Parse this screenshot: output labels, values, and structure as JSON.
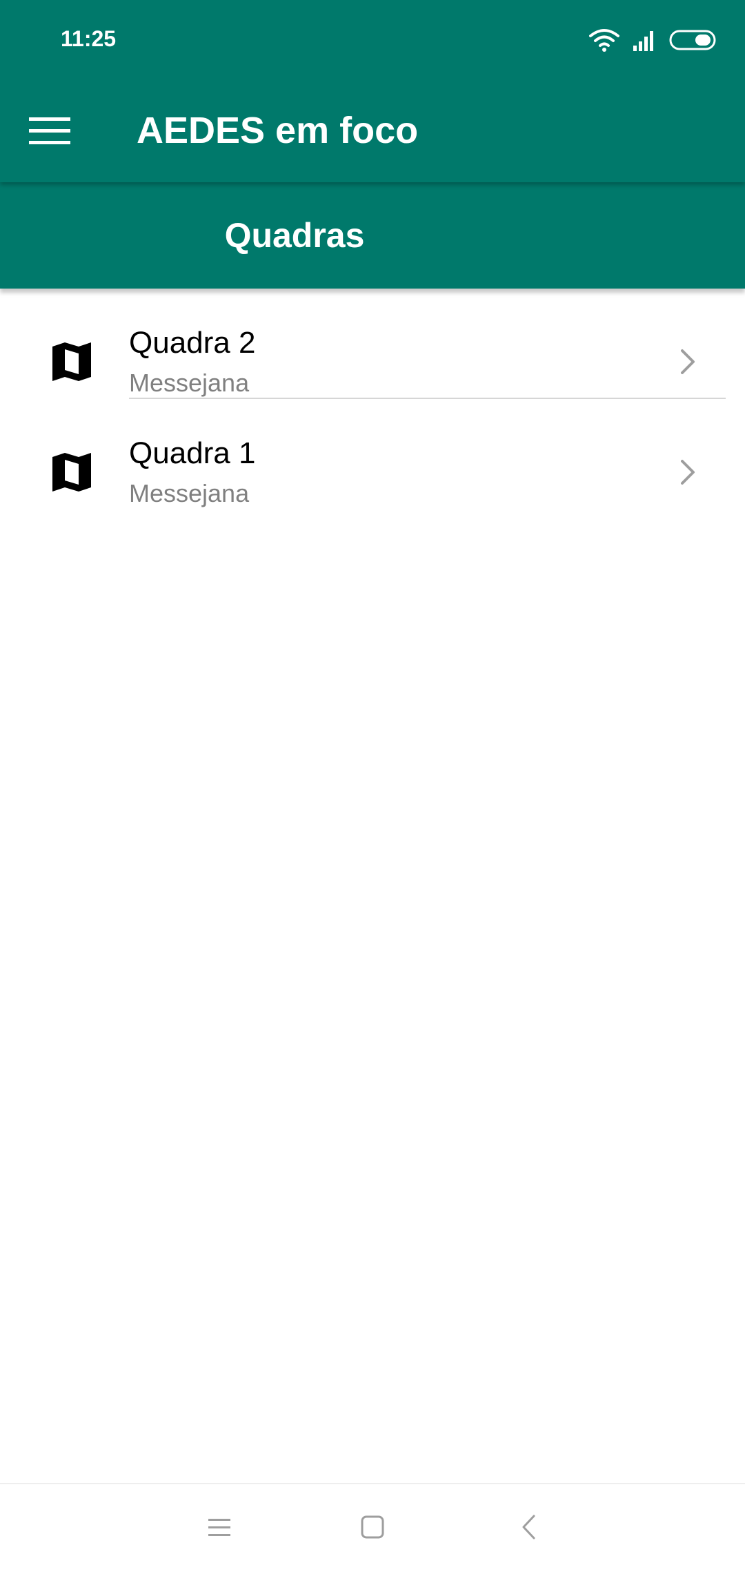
{
  "status_bar": {
    "time": "11:25",
    "icons": [
      "wifi-icon",
      "signal-icon",
      "battery-icon"
    ]
  },
  "toolbar": {
    "menu_icon": "menu-icon",
    "title": "AEDES em foco"
  },
  "tabs": [
    {
      "label": "Quadras",
      "selected": true
    }
  ],
  "quadras": [
    {
      "title": "Quadra 2",
      "subtitle": "Messejana",
      "icon": "map-icon"
    },
    {
      "title": "Quadra 1",
      "subtitle": "Messejana",
      "icon": "map-icon"
    }
  ],
  "nav_bar": {
    "buttons": [
      "menu-icon",
      "home-square-icon",
      "back-icon"
    ]
  },
  "colors": {
    "primary": "#00796b",
    "text_primary": "#000000",
    "text_secondary": "#808080",
    "divider": "#d6d6d6",
    "chevron": "#9e9e9e"
  }
}
